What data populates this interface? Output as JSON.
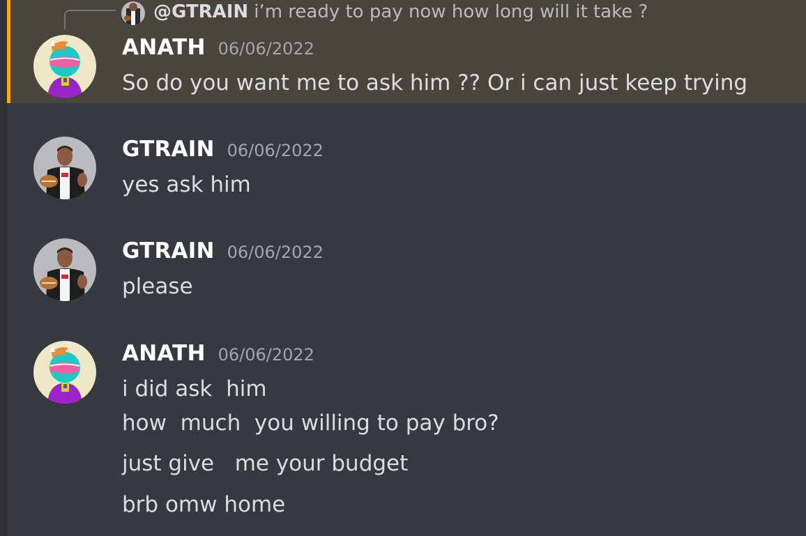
{
  "reply": {
    "mention": "@GTRAIN",
    "text": "i’m ready to pay now how long will it take ?"
  },
  "messages": [
    {
      "author": "ANATH",
      "timestamp": "06/06/2022",
      "lines": [
        "So do you want me to ask him ?? Or i can just keep trying"
      ]
    },
    {
      "author": "GTRAIN",
      "timestamp": "06/06/2022",
      "lines": [
        "yes ask him"
      ]
    },
    {
      "author": "GTRAIN",
      "timestamp": "06/06/2022",
      "lines": [
        "please"
      ]
    },
    {
      "author": "ANATH",
      "timestamp": "06/06/2022",
      "lines": [
        "i did ask  him",
        "how  much  you willing to pay bro?",
        "just give   me your budget",
        "brb omw home"
      ]
    }
  ]
}
